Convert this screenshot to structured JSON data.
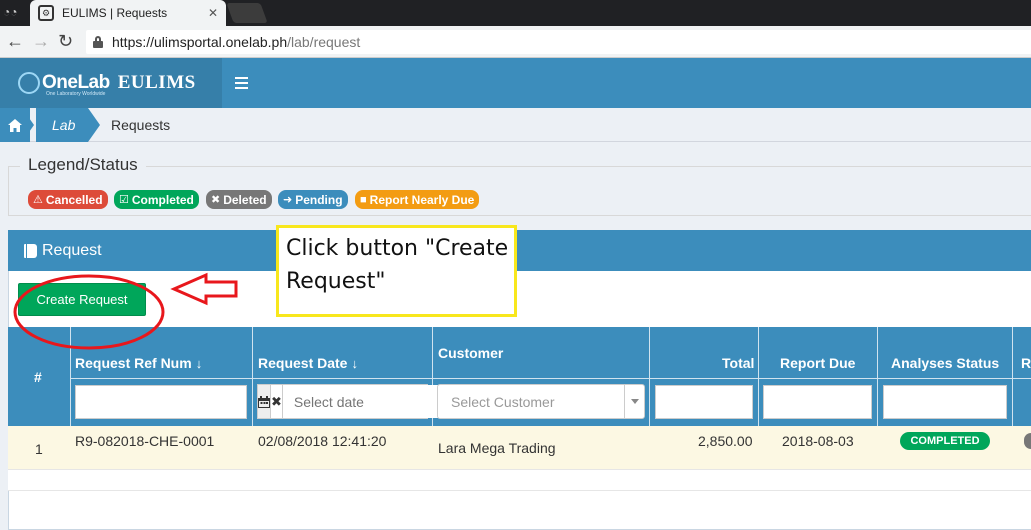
{
  "browser": {
    "tab_title": "EULIMS | Requests",
    "tab_close": "✕",
    "url_host": "https://ulimsportal.onelab.ph",
    "url_path": "/lab/request",
    "back": "←",
    "forward": "→",
    "reload": "↻"
  },
  "app": {
    "logo_onelab": "OneLab",
    "logo_eulims": "EULIMS",
    "logo_tagline": "One Laboratory Worldwide",
    "menu_icon": "hamburger-icon"
  },
  "breadcrumb": {
    "items": [
      "Lab"
    ],
    "current": "Requests"
  },
  "legend": {
    "title": "Legend/Status",
    "badges": [
      {
        "label": "Cancelled",
        "icon": "⚠",
        "color": "#dd4b39"
      },
      {
        "label": "Completed",
        "icon": "☑",
        "color": "#00a65a"
      },
      {
        "label": "Deleted",
        "icon": "✖",
        "color": "#777777"
      },
      {
        "label": "Pending",
        "icon": "➜",
        "color": "#3c8dbc"
      },
      {
        "label": "Report Nearly Due",
        "icon": "■",
        "color": "#f39c12"
      }
    ]
  },
  "panel": {
    "title": "Request",
    "create_button": "Create Request"
  },
  "grid": {
    "columns": [
      "#",
      "Request Ref Num",
      "Request Date",
      "Customer",
      "Total",
      "Report Due",
      "Analyses Status",
      "R"
    ],
    "sort_icon": "↓",
    "date_placeholder": "Select date",
    "customer_placeholder": "Select Customer",
    "rows": [
      {
        "num": "1",
        "ref": "R9-082018-CHE-0001",
        "date": "02/08/2018 12:41:20",
        "customer": "Lara Mega Trading",
        "total": "2,850.00",
        "due": "2018-08-03",
        "status": "COMPLETED"
      }
    ]
  },
  "annotation": {
    "callout_text": "Click button \"Create Request\""
  },
  "colors": {
    "primary": "#3c8dbc",
    "success": "#00a65a",
    "highlight_row": "#fcf8e3",
    "callout_border": "#f8e71c",
    "marker_red": "#e8171c"
  }
}
